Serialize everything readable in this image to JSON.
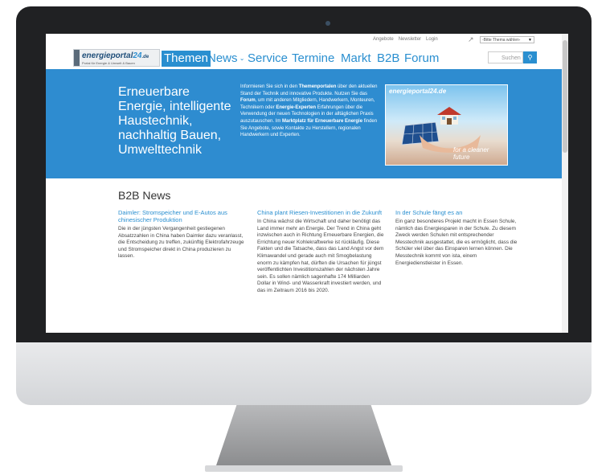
{
  "topbar": {
    "links": [
      "Angebote",
      "Newsletter",
      "Login"
    ],
    "theme_select": "-Bitte Thema wählen-"
  },
  "logo": {
    "name_main": "energieportal",
    "name_num": "24",
    "name_tld": ".de",
    "tagline": "Portal für Energie & Umwelt & Bauen"
  },
  "nav": {
    "items": [
      "Themen",
      "News",
      "Service",
      "Termine",
      "Markt",
      "B2B",
      "Forum"
    ],
    "active": "Themen"
  },
  "search": {
    "placeholder": "Suchen"
  },
  "hero": {
    "title": "Erneuerbare Energie, intelligente Haustechnik, nachhaltig Bauen, Umwelttechnik",
    "text_parts": [
      "Informieren Sie sich in den ",
      "Themenportalen",
      " über den aktuellen Stand der Technik und innovative Produkte. Nutzen Sie das ",
      "Forum",
      ", um mit anderen Mitgliedern, Handwerkern, Monteuren, Technikern oder ",
      "Energie-Experten",
      " Erfahrungen über die Verwendung der neuen Technologien in der alltäglichen Praxis auszutauschen. Im ",
      "Marktplatz für Erneuerbare Energie",
      " finden Sie Angebote, sowie Kontakte zu Herstellern, regionalen Handwerkern und Experten."
    ],
    "image_title": "energieportal24.de",
    "image_tagline": "for a cleaner future"
  },
  "b2b": {
    "title": "B2B News",
    "articles": [
      {
        "headline": "Daimler: Stromspeicher und E-Autos aus chinesischer Produktion",
        "body": "Die in der jüngsten Vergangenheit gestiegenen Absatzzahlen in China haben Daimler dazu veranlasst, die Entscheidung zu treffen, zukünftig Elektrofahrzeuge und Stromspeicher direkt in China produzieren zu lassen."
      },
      {
        "headline": "China plant Riesen-Investitionen in die Zukunft",
        "body": "In China wächst die Wirtschaft und daher benötigt das Land immer mehr an Energie. Der Trend in China geht inzwischen auch in Richtung Erneuerbare Energien, die Errichtung neuer Kohlekraftwerke ist rückläufig. Diese Fakten und die Tatsache, dass das Land Angst vor dem Klimawandel und gerade auch mit Smogbelastung enorm zu kämpfen hat, dürften die Ursachen für jüngst veröffentlichten Investitionszahlen der nächsten Jahre sein. Es sollen nämlich sagenhafte 174 Milliarden Dollar in Wind- und Wasserkraft investiert werden, und das im Zeitraum 2016 bis 2020."
      },
      {
        "headline": "In der Schule fängt es an",
        "body": "Ein ganz besonderes Projekt macht in Essen Schule, nämlich das Energiesparen in der Schule. Zu diesem Zweck werden Schulen mit entsprechender Messtechnik ausgestattet, die es ermöglicht, dass die Schüler viel über das Einsparen lernen können. Die Messtechnik kommt von ista, einem Energiedienstleister in Essen."
      }
    ]
  },
  "colors": {
    "brand_blue": "#2a8fd0",
    "hero_blue": "#2e8cd0",
    "bezel": "#202123"
  }
}
